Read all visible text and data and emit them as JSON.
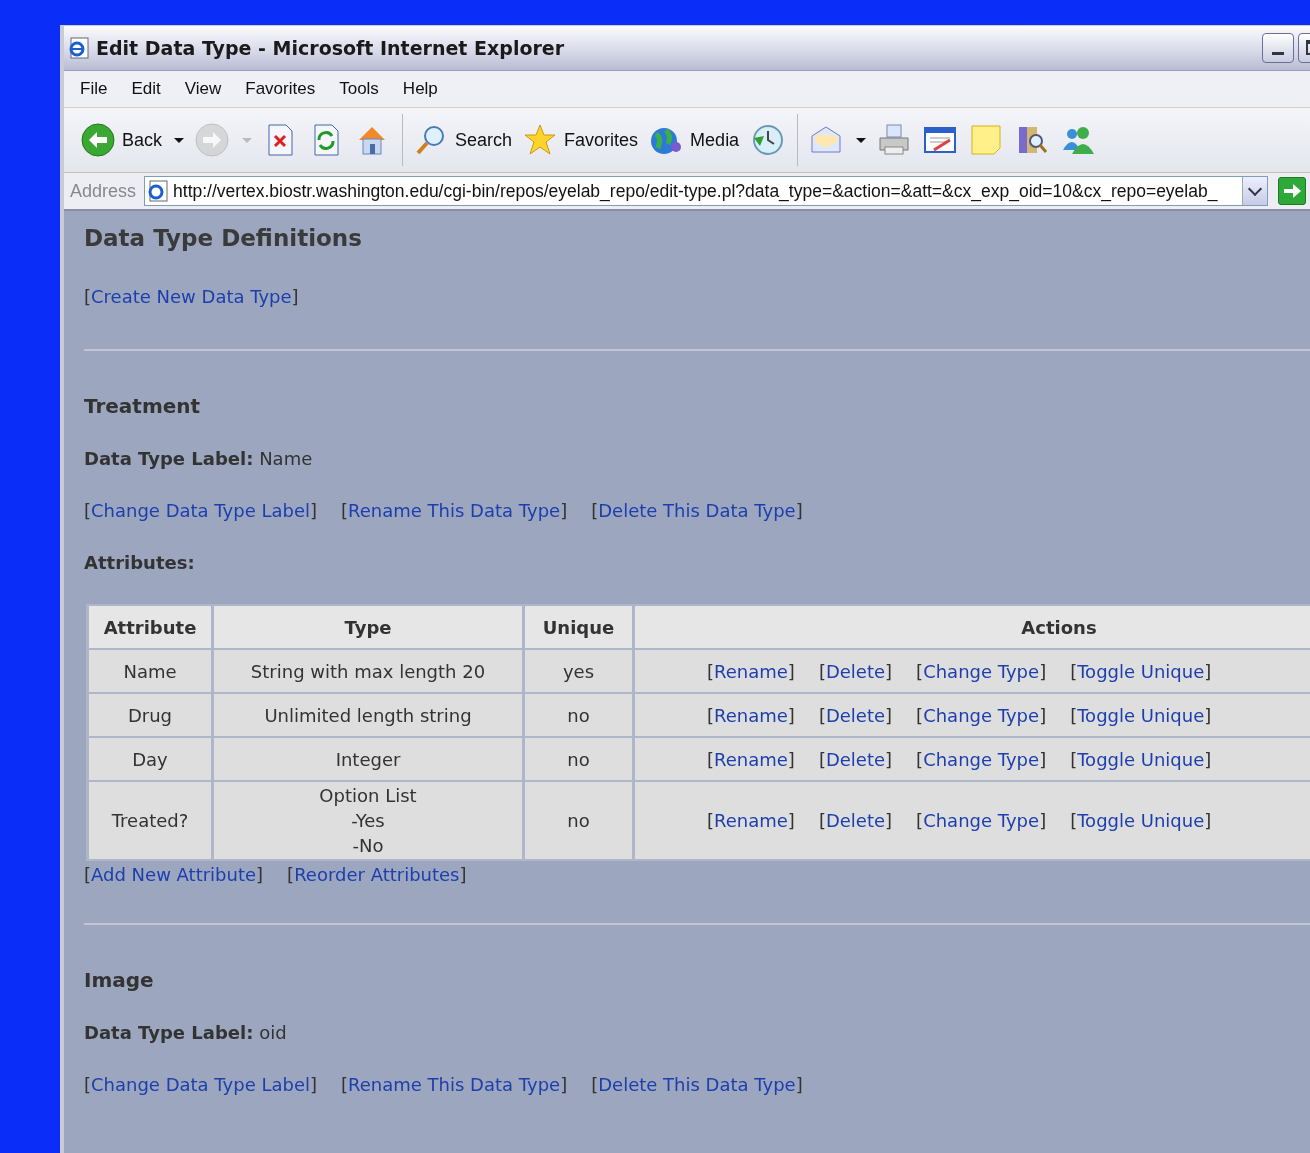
{
  "window": {
    "title": "Edit Data Type - Microsoft Internet Explorer"
  },
  "menu": [
    {
      "label": "File"
    },
    {
      "label": "Edit"
    },
    {
      "label": "View"
    },
    {
      "label": "Favorites"
    },
    {
      "label": "Tools"
    },
    {
      "label": "Help"
    }
  ],
  "toolbar": [
    {
      "kind": "back",
      "label": "Back",
      "dropdown": true,
      "disabled": false
    },
    {
      "kind": "forward",
      "dropdown": true,
      "disabled": true
    },
    {
      "kind": "stop",
      "disabled": false
    },
    {
      "kind": "refresh",
      "disabled": false
    },
    {
      "kind": "home",
      "disabled": false
    },
    {
      "kind": "separator"
    },
    {
      "kind": "search",
      "label": "Search",
      "disabled": false
    },
    {
      "kind": "favorites",
      "label": "Favorites",
      "disabled": false
    },
    {
      "kind": "media",
      "label": "Media",
      "disabled": false
    },
    {
      "kind": "history",
      "disabled": false
    },
    {
      "kind": "separator"
    },
    {
      "kind": "mail",
      "dropdown": true,
      "disabled": false
    },
    {
      "kind": "print",
      "disabled": false
    },
    {
      "kind": "edit",
      "disabled": false
    },
    {
      "kind": "note",
      "disabled": false
    },
    {
      "kind": "research",
      "disabled": false
    },
    {
      "kind": "messenger",
      "disabled": false
    }
  ],
  "address": {
    "label": "Address",
    "value": "http://vertex.biostr.washington.edu/cgi-bin/repos/eyelab_repo/edit-type.pl?data_type=&action=&att=&cx_exp_oid=10&cx_repo=eyelab_"
  },
  "brackets": [
    "[",
    "]"
  ],
  "page": {
    "heading": "Data Type Definitions",
    "create_link": "Create New Data Type",
    "sections": [
      {
        "name": "Treatment",
        "label_caption": "Data Type Label:",
        "label_value": "Name",
        "links": [
          "Change Data Type Label",
          "Rename This Data Type",
          "Delete This Data Type"
        ],
        "attributes_caption": "Attributes:",
        "table": {
          "columns": [
            "Attribute",
            "Type",
            "Unique",
            "Actions"
          ],
          "rows": [
            {
              "attribute": "Name",
              "type": [
                "String with max length 20"
              ],
              "unique": "yes",
              "actions": [
                "Rename",
                "Delete",
                "Change Type",
                "Toggle Unique"
              ]
            },
            {
              "attribute": "Drug",
              "type": [
                "Unlimited length string"
              ],
              "unique": "no",
              "actions": [
                "Rename",
                "Delete",
                "Change Type",
                "Toggle Unique"
              ]
            },
            {
              "attribute": "Day",
              "type": [
                "Integer"
              ],
              "unique": "no",
              "actions": [
                "Rename",
                "Delete",
                "Change Type",
                "Toggle Unique"
              ]
            },
            {
              "attribute": "Treated?",
              "type": [
                "Option List",
                "-Yes",
                "-No"
              ],
              "unique": "no",
              "actions": [
                "Rename",
                "Delete",
                "Change Type",
                "Toggle Unique"
              ]
            }
          ]
        },
        "table_links": [
          "Add New Attribute",
          "Reorder Attributes"
        ]
      },
      {
        "name": "Image",
        "label_caption": "Data Type Label:",
        "label_value": "oid",
        "links": [
          "Change Data Type Label",
          "Rename This Data Type",
          "Delete This Data Type"
        ]
      }
    ]
  }
}
